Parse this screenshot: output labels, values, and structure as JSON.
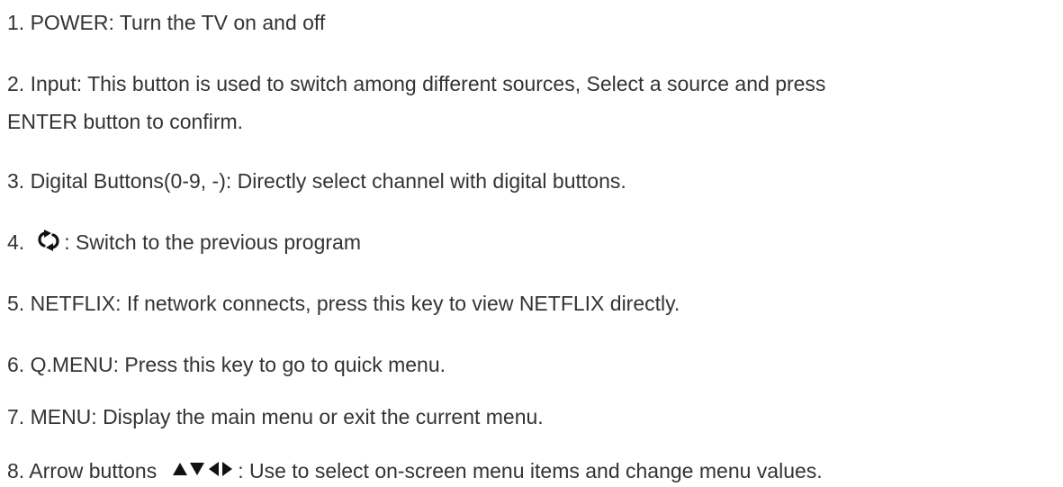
{
  "items": [
    {
      "text": "1. POWER: Turn the TV on and off"
    },
    {
      "line1": "2. Input: This button is used to switch among different sources, Select a source and press",
      "line2": "ENTER button to confirm."
    },
    {
      "text": "3. Digital Buttons(0-9, -): Directly select channel with digital buttons."
    },
    {
      "prefix": "4.",
      "icon": "previous-channel-icon",
      "suffix": ": Switch to the previous program"
    },
    {
      "text": "5. NETFLIX: If network connects, press this key to view NETFLIX directly."
    },
    {
      "text": "6. Q.MENU: Press this key to go to quick menu."
    },
    {
      "text": "7. MENU: Display the main menu or exit the current menu."
    },
    {
      "prefix": "8. Arrow buttons",
      "icon": "arrow-buttons-icon",
      "suffix": ": Use to select on-screen menu items and change menu values."
    }
  ]
}
